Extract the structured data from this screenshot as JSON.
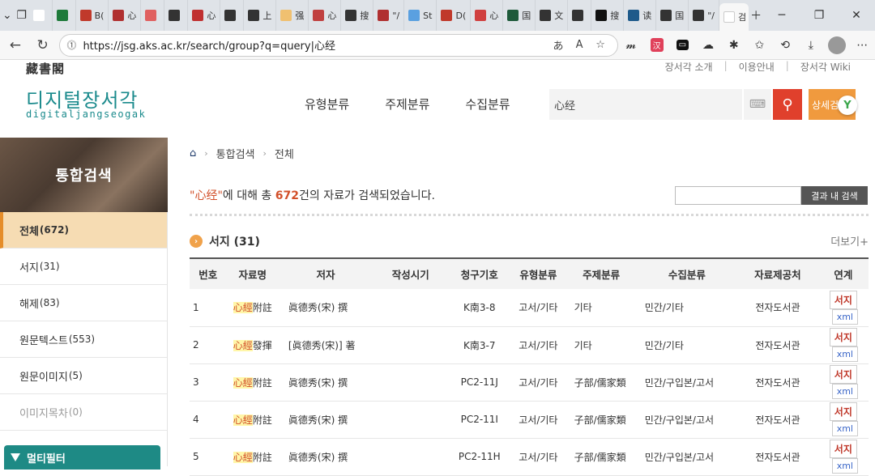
{
  "browser": {
    "tabs": [
      {
        "label": "",
        "color": "#ffffff"
      },
      {
        "label": "",
        "color": "#1e7a3a"
      },
      {
        "label": "B(",
        "color": "#c0392b"
      },
      {
        "label": "心",
        "color": "#b03030"
      },
      {
        "label": "",
        "color": "#e06060"
      },
      {
        "label": "",
        "color": "#333333"
      },
      {
        "label": "心",
        "color": "#c03030"
      },
      {
        "label": "",
        "color": "#333333"
      },
      {
        "label": "上",
        "color": "#333333"
      },
      {
        "label": "强",
        "color": "#f0c070"
      },
      {
        "label": "心",
        "color": "#c04040"
      },
      {
        "label": "搜",
        "color": "#333333"
      },
      {
        "label": "\"/",
        "color": "#b03030"
      },
      {
        "label": "St",
        "color": "#5aa0e0"
      },
      {
        "label": "D(",
        "color": "#c0392b"
      },
      {
        "label": "心",
        "color": "#d04040"
      },
      {
        "label": "国",
        "color": "#1e5a3a"
      },
      {
        "label": "文",
        "color": "#333333"
      },
      {
        "label": "",
        "color": "#333333"
      },
      {
        "label": "搜",
        "color": "#111111"
      },
      {
        "label": "读",
        "color": "#1e5a8a"
      },
      {
        "label": "国",
        "color": "#333333"
      },
      {
        "label": "\"/",
        "color": "#333333"
      }
    ],
    "active_tab_label": "검",
    "url": "https://jsg.aks.ac.kr/search/group?q=query|心经"
  },
  "site": {
    "logo_hanja": "藏書閣",
    "logo_title": "디지털장서각",
    "logo_sub": "digitaljangseogak",
    "top_links": [
      "장서각 소개",
      "이용안내",
      "장서각 Wiki"
    ],
    "gnb": [
      "유형분류",
      "주제분류",
      "수집분류"
    ],
    "search_value": "心经",
    "detail_search_label": "상세검"
  },
  "sidebar": {
    "title": "통합검색",
    "items": [
      {
        "label": "전체",
        "count": "(672)",
        "active": true
      },
      {
        "label": "서지",
        "count": "(31)"
      },
      {
        "label": "해제",
        "count": "(83)"
      },
      {
        "label": "원문텍스트",
        "count": "(553)"
      },
      {
        "label": "원문이미지",
        "count": "(5)"
      },
      {
        "label": "이미지목차",
        "count": "(0)",
        "muted": true
      }
    ],
    "multifilter": "멀티필터"
  },
  "content": {
    "breadcrumb": [
      "통합검색",
      "전체"
    ],
    "summary": {
      "query": "\"心经\"",
      "mid": "에 대해 총 ",
      "count": "672",
      "tail": "건의 자료가 검색되었습니다."
    },
    "result_search_btn": "결과 내 검색",
    "section_title": "서지 (31)",
    "more": "더보기+",
    "table": {
      "headers": [
        "번호",
        "자료명",
        "저자",
        "작성시기",
        "청구기호",
        "유형분류",
        "주제분류",
        "수집분류",
        "자료제공처",
        "연계"
      ],
      "rows": [
        {
          "no": "1",
          "title_hl": "心經",
          "title_rest": "附註",
          "author": "眞德秀(宋) 撰",
          "date": "",
          "call": "K南3-8",
          "type": "고서/기타",
          "subject": "기타",
          "collect": "민간/기타",
          "provider": "전자도서관",
          "link1": "서지",
          "link2": "xml"
        },
        {
          "no": "2",
          "title_hl": "心經",
          "title_rest": "發揮",
          "author": "[眞德秀(宋)] 著",
          "date": "",
          "call": "K南3-7",
          "type": "고서/기타",
          "subject": "기타",
          "collect": "민간/기타",
          "provider": "전자도서관",
          "link1": "서지",
          "link2": "xml"
        },
        {
          "no": "3",
          "title_hl": "心經",
          "title_rest": "附註",
          "author": "眞德秀(宋) 撰",
          "date": "",
          "call": "PC2-11J",
          "type": "고서/기타",
          "subject": "子部/儒家類",
          "collect": "민간/구입본/고서",
          "provider": "전자도서관",
          "link1": "서지",
          "link2": "xml"
        },
        {
          "no": "4",
          "title_hl": "心經",
          "title_rest": "附註",
          "author": "眞德秀(宋) 撰",
          "date": "",
          "call": "PC2-11I",
          "type": "고서/기타",
          "subject": "子部/儒家類",
          "collect": "민간/구입본/고서",
          "provider": "전자도서관",
          "link1": "서지",
          "link2": "xml"
        },
        {
          "no": "5",
          "title_hl": "心經",
          "title_rest": "附註",
          "author": "眞德秀(宋) 撰",
          "date": "",
          "call": "PC2-11H",
          "type": "고서/기타",
          "subject": "子部/儒家類",
          "collect": "민간/구입본/고서",
          "provider": "전자도서관",
          "link1": "서지",
          "link2": "xml"
        }
      ]
    }
  },
  "colors": {
    "accent_teal": "#1a8a8c",
    "search_red": "#e0402c",
    "detail_orange": "#f09a3e",
    "active_side": "#f6dcb3",
    "highlight": "#d2502a"
  }
}
